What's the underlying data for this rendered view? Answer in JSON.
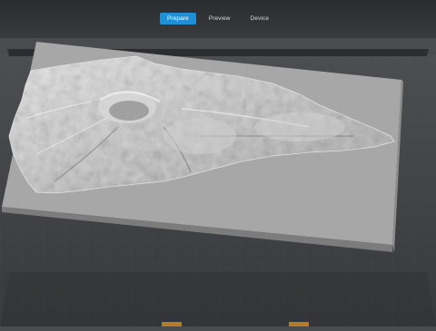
{
  "tabs": [
    {
      "label": "Prepare",
      "active": true
    },
    {
      "label": "Preview",
      "active": false
    },
    {
      "label": "Device",
      "active": false
    }
  ],
  "colors": {
    "accent": "#1e90d6",
    "plate": "#a9a9a9",
    "bed": "#3b3c3f",
    "terrain": "#c8c8c8"
  }
}
